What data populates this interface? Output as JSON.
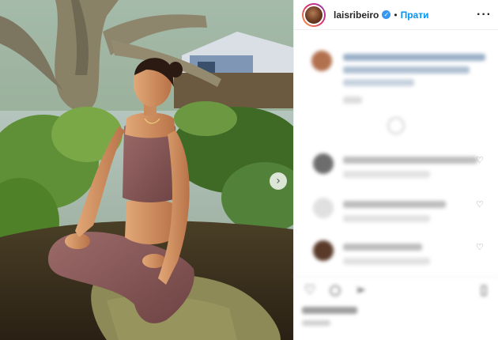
{
  "post": {
    "username": "laisribeiro",
    "follow_label": "Прати",
    "verified_mark": "✓",
    "separator": "•",
    "more_label": "···"
  },
  "photo": {
    "next_label": "›"
  },
  "icons": {
    "like": "heart-icon",
    "comment": "comment-icon",
    "share": "share-icon",
    "save": "bookmark-icon"
  },
  "colors": {
    "accent": "#0095f6",
    "verified": "#3897f0",
    "text": "#262626",
    "muted": "#8e8e8e"
  }
}
